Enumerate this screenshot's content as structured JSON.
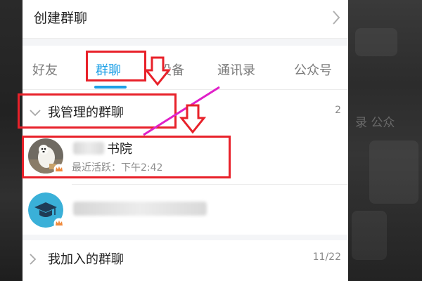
{
  "create_group": {
    "label": "创建群聊"
  },
  "tabs": [
    {
      "label": "好友",
      "active": false
    },
    {
      "label": "群聊",
      "active": true
    },
    {
      "label": "设备",
      "active": false
    },
    {
      "label": "通讯录",
      "active": false
    },
    {
      "label": "公众号",
      "active": false
    }
  ],
  "managed_groups": {
    "title": "我管理的群聊",
    "count": "2",
    "items": [
      {
        "name_visible": "书院",
        "subtitle": "最近活跃：下午2:42",
        "avatar": "dog-photo"
      },
      {
        "name_visible": "",
        "subtitle": "",
        "avatar": "graduation-cap"
      }
    ]
  },
  "joined_groups": {
    "title": "我加入的群聊",
    "count": "11/22"
  },
  "background_ghost": {
    "text": "录      公众"
  },
  "colors": {
    "accent": "#1ea0e6",
    "annotation_red": "#e8212a",
    "annotation_magenta": "#e020c8",
    "avatar_teal": "#3ab0d8"
  }
}
